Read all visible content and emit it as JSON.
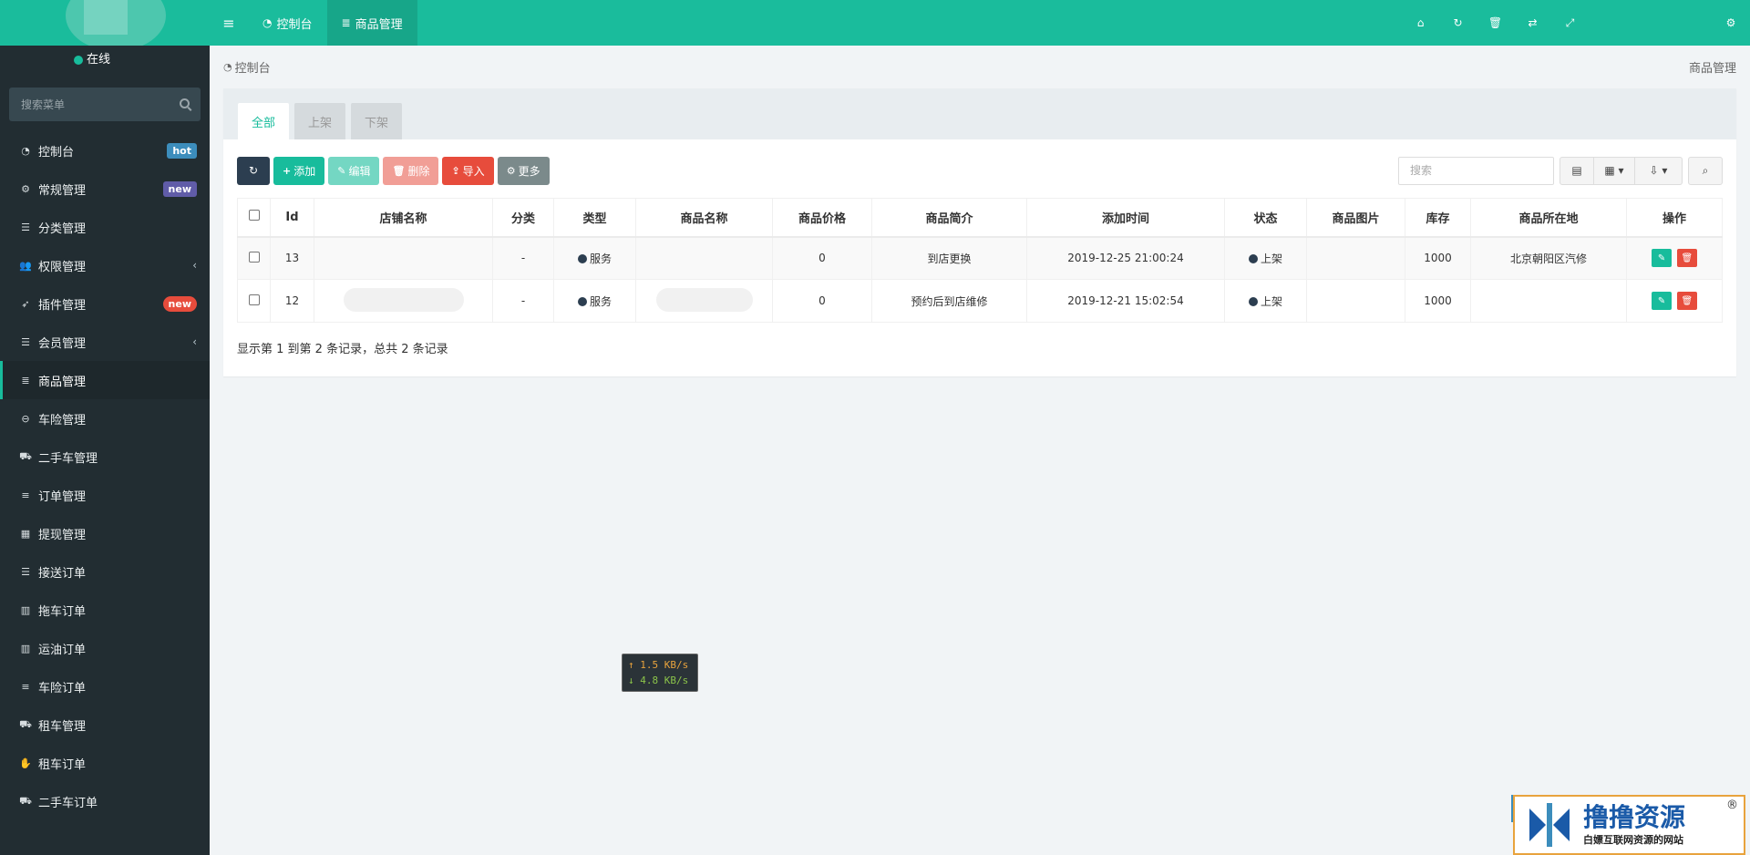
{
  "sidebar": {
    "status": "在线",
    "search_placeholder": "搜索菜单",
    "items": [
      {
        "label": "控制台",
        "icon": "dashboard-icon",
        "glyph": "◔",
        "badge": "hot"
      },
      {
        "label": "常规管理",
        "icon": "cogs-icon",
        "glyph": "⚙",
        "badge": "new"
      },
      {
        "label": "分类管理",
        "icon": "list-icon",
        "glyph": "☰"
      },
      {
        "label": "权限管理",
        "icon": "users-icon",
        "glyph": "👥",
        "chevron": "‹"
      },
      {
        "label": "插件管理",
        "icon": "rocket-icon",
        "glyph": "➶",
        "badge": "new"
      },
      {
        "label": "会员管理",
        "icon": "list-icon",
        "glyph": "☰",
        "chevron": "‹"
      },
      {
        "label": "商品管理",
        "icon": "database-icon",
        "glyph": "≣"
      },
      {
        "label": "车险管理",
        "icon": "minus-circle-icon",
        "glyph": "⊖"
      },
      {
        "label": "二手车管理",
        "icon": "car-icon",
        "glyph": "⛟"
      },
      {
        "label": "订单管理",
        "icon": "align-left-icon",
        "glyph": "≡"
      },
      {
        "label": "提现管理",
        "icon": "calculator-icon",
        "glyph": "▦"
      },
      {
        "label": "接送订单",
        "icon": "list-icon",
        "glyph": "☰"
      },
      {
        "label": "拖车订单",
        "icon": "bar-chart-icon",
        "glyph": "▥"
      },
      {
        "label": "运油订单",
        "icon": "bar-chart-icon",
        "glyph": "▥"
      },
      {
        "label": "车险订单",
        "icon": "align-left-icon",
        "glyph": "≡"
      },
      {
        "label": "租车管理",
        "icon": "car-icon",
        "glyph": "⛟"
      },
      {
        "label": "租车订单",
        "icon": "handshake-icon",
        "glyph": "✋"
      },
      {
        "label": "二手车订单",
        "icon": "car-icon",
        "glyph": "⛟"
      }
    ]
  },
  "header": {
    "tabs": [
      {
        "label": "控制台",
        "icon": "dashboard-icon"
      },
      {
        "label": "商品管理",
        "icon": "database-icon"
      }
    ]
  },
  "breadcrumb": {
    "left": "控制台",
    "right": "商品管理"
  },
  "panel_tabs": [
    "全部",
    "上架",
    "下架"
  ],
  "toolbar": {
    "add": "添加",
    "edit": "编辑",
    "delete": "删除",
    "import": "导入",
    "more": "更多",
    "search_placeholder": "搜索"
  },
  "table": {
    "columns": [
      "Id",
      "店铺名称",
      "分类",
      "类型",
      "商品名称",
      "商品价格",
      "商品简介",
      "添加时间",
      "状态",
      "商品图片",
      "库存",
      "商品所在地",
      "操作"
    ],
    "rows": [
      {
        "id": "13",
        "shop": "",
        "category": "-",
        "type": "服务",
        "name": "",
        "price": "0",
        "intro": "到店更换",
        "time": "2019-12-25 21:00:24",
        "status": "上架",
        "image": "",
        "stock": "1000",
        "location": "北京朝阳区汽修"
      },
      {
        "id": "12",
        "shop": "",
        "category": "-",
        "type": "服务",
        "name": "",
        "price": "0",
        "intro": "预约后到店维修",
        "time": "2019-12-21 15:02:54",
        "status": "上架",
        "image": "",
        "stock": "1000",
        "location": ""
      }
    ],
    "summary": "显示第 1 到第 2 条记录，总共 2 条记录"
  },
  "speed": {
    "up": "↑ 1.5 KB/s",
    "down": "↓ 4.8 KB/s"
  },
  "watermark": {
    "title": "撸撸资源",
    "subtitle": "白嫖互联网资源的网站",
    "reg": "®"
  }
}
